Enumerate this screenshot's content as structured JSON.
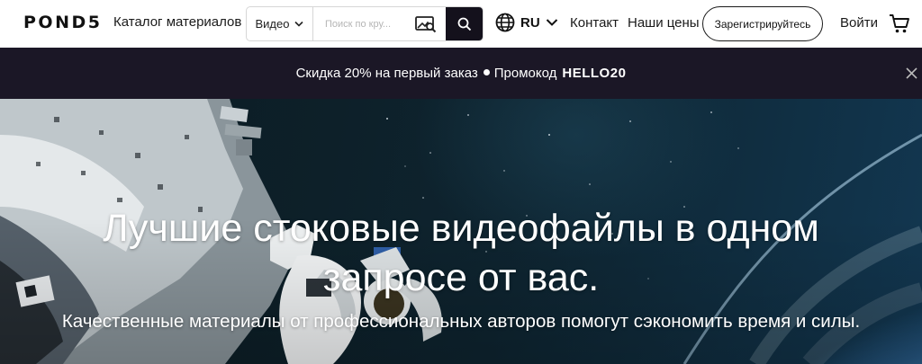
{
  "header": {
    "logo": "POND5",
    "catalog_label": "Каталог материалов",
    "search": {
      "type_label": "Видео",
      "placeholder": "Поиск по кру..."
    },
    "language": "RU",
    "contact_label": "Контакт",
    "pricing_label": "Наши цены",
    "register_label": "Зарегистрируйтесь",
    "login_label": "Войти"
  },
  "promo": {
    "text": "Скидка 20% на первый заказ",
    "promo_label": "Промокод",
    "code": "HELLO20"
  },
  "hero": {
    "title_line1": "Лучшие стоковые видеофайлы в одном",
    "title_line2": "запросе от вас.",
    "subtitle": "Качественные материалы от профессиональных авторов помогут сэкономить время и силы."
  },
  "icons": {
    "catalog": "chevron-down-icon",
    "search_type": "chevron-down-icon",
    "image_search": "image-search-icon",
    "search": "search-icon",
    "language": "globe-icon",
    "cart": "cart-icon",
    "close": "close-icon"
  },
  "colors": {
    "promo_bg": "#1b1726",
    "search_button_bg": "#14111c"
  }
}
